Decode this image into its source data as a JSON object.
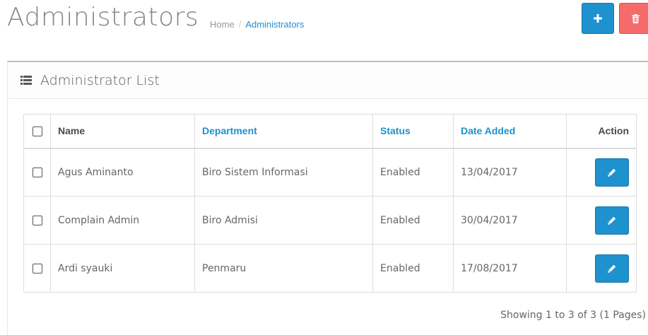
{
  "header": {
    "title": "Administrators",
    "breadcrumb": [
      {
        "label": "Home"
      },
      {
        "label": "Administrators"
      }
    ]
  },
  "toolbar": {
    "add_icon": "plus-icon",
    "delete_icon": "trash-icon",
    "add_color": "#1e91cf",
    "delete_color": "#f56b6b"
  },
  "panel": {
    "title": "Administrator List",
    "icon": "list-icon"
  },
  "table": {
    "columns": {
      "name": "Name",
      "department": "Department",
      "status": "Status",
      "date_added": "Date Added",
      "action": "Action"
    },
    "rows": [
      {
        "name": "Agus Aminanto",
        "department": "Biro Sistem Informasi",
        "status": "Enabled",
        "date_added": "13/04/2017"
      },
      {
        "name": "Complain Admin",
        "department": "Biro Admisi",
        "status": "Enabled",
        "date_added": "30/04/2017"
      },
      {
        "name": "Ardi syauki",
        "department": "Penmaru",
        "status": "Enabled",
        "date_added": "17/08/2017"
      }
    ]
  },
  "pagination": {
    "summary": "Showing 1 to 3 of 3 (1 Pages)"
  }
}
